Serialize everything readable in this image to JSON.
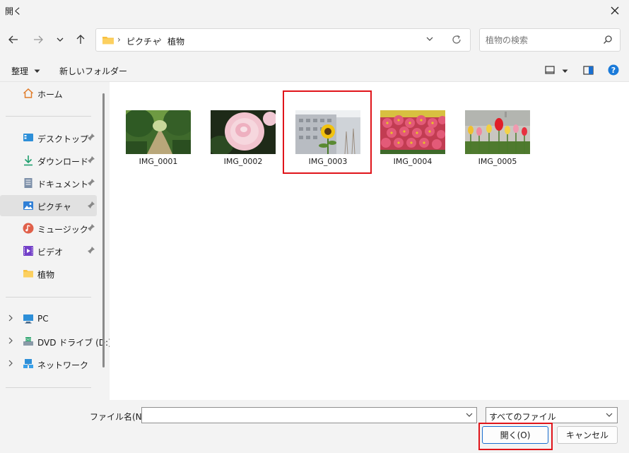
{
  "window": {
    "title": "開く"
  },
  "address": {
    "crumbs": [
      "ピクチャ",
      "植物"
    ]
  },
  "search": {
    "placeholder": "植物の検索"
  },
  "toolbar": {
    "organize": "整理",
    "new_folder": "新しいフォルダー"
  },
  "sidebar": {
    "home": "ホーム",
    "desktop": "デスクトップ",
    "downloads": "ダウンロード",
    "documents": "ドキュメント",
    "pictures": "ピクチャ",
    "music": "ミュージック",
    "videos": "ビデオ",
    "plants": "植物",
    "pc": "PC",
    "dvd": "DVD ドライブ (D:)",
    "network": "ネットワーク"
  },
  "files": [
    {
      "name": "IMG_0001"
    },
    {
      "name": "IMG_0002"
    },
    {
      "name": "IMG_0003",
      "selected": true
    },
    {
      "name": "IMG_0004"
    },
    {
      "name": "IMG_0005"
    }
  ],
  "bottom": {
    "filename_label": "ファイル名(N):",
    "filename_value": "",
    "filetype": "すべてのファイル",
    "open_button": "開く(O)",
    "cancel_button": "キャンセル"
  },
  "colors": {
    "accent": "#1a6fd0",
    "highlight": "#e0141a",
    "help": "#1a7ad9"
  }
}
